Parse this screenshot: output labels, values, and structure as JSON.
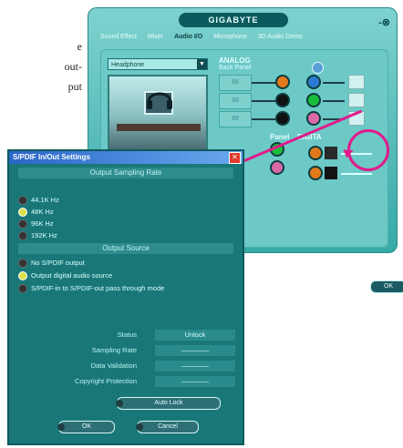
{
  "document": {
    "lines": [
      "e",
      "out-",
      "put"
    ]
  },
  "background_window": {
    "brand": "GIGABYTE",
    "controls": "-⊗",
    "tabs": [
      "Sound Effect",
      "Mixer",
      "Audio I/O",
      "Microphone",
      "3D Audio Demo"
    ],
    "active_tab": "Audio I/O",
    "device_select": "Headphone",
    "analog_label": "ANALOG",
    "back_panel_label": "Back Panel",
    "panel_label": "Panel",
    "digital_label": "DIGITA",
    "ok": "OK",
    "colors": {
      "jacks": [
        "#e07a1a",
        "#2a7bd1",
        "#1bbd3b",
        "#d96aa7",
        "#101010",
        "#ffffff"
      ],
      "highlight": "#e01a8b"
    }
  },
  "dialog": {
    "title": "S/PDIF In/Out Settings",
    "close": "✕",
    "sampling_header": "Output Sampling Rate",
    "sampling_options": [
      {
        "label": "44.1K Hz",
        "selected": false
      },
      {
        "label": "48K Hz",
        "selected": true
      },
      {
        "label": "96K Hz",
        "selected": false
      },
      {
        "label": "192K Hz",
        "selected": false
      }
    ],
    "source_header": "Output Source",
    "source_options": [
      {
        "label": "No S/PDIF output",
        "selected": false
      },
      {
        "label": "Output digital audio source",
        "selected": true
      },
      {
        "label": "S/PDIF-in to S/PDIF-out pass through mode",
        "selected": false
      }
    ],
    "status": [
      {
        "label": "Status",
        "value": "Unlock"
      },
      {
        "label": "Sampling Rate",
        "value": "————"
      },
      {
        "label": "Data Validation",
        "value": "————"
      },
      {
        "label": "Copyright Protection",
        "value": "————"
      }
    ],
    "buttons": {
      "auto_lock": "Auto Lock",
      "ok": "OK",
      "cancel": "Cancel"
    }
  }
}
